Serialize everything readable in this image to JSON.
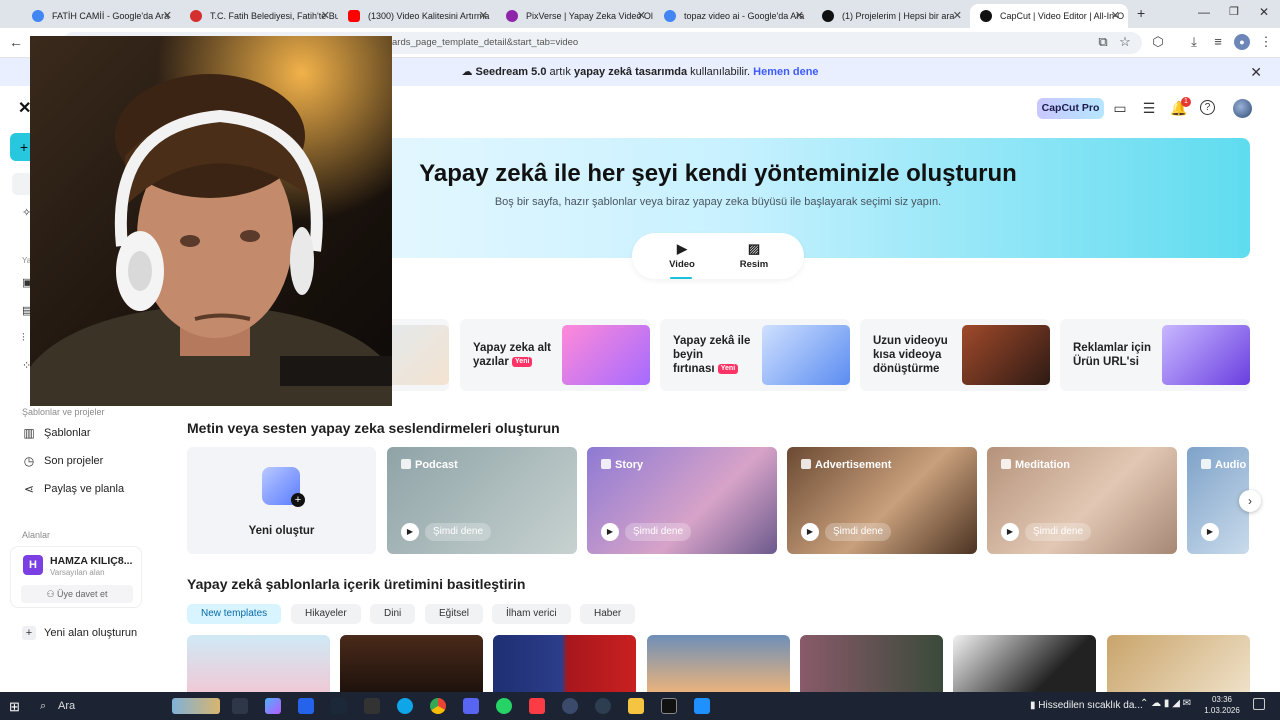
{
  "browser": {
    "tabs": [
      {
        "label": "FATİH CAMİİ - Google'da Ara",
        "color": "#4285f4"
      },
      {
        "label": "T.C. Fatih Belediyesi, Fatih'te Bu",
        "color": "#d32f2f"
      },
      {
        "label": "(1300) Video Kalitesini Artırma",
        "color": "#ff0000"
      },
      {
        "label": "PixVerse | Yapay Zeka Video Ol",
        "color": "#8e24aa"
      },
      {
        "label": "topaz video ai - Google'da Ara",
        "color": "#4285f4"
      },
      {
        "label": "(1) Projelerim | Hepsi bir ara",
        "color": "#111111"
      },
      {
        "label": "CapCut | Video Editor | All-In-O",
        "color": "#111111"
      }
    ],
    "address": "ards_page_template_detail&start_tab=video"
  },
  "banner": {
    "brand": "Seedream 5.0",
    "text_1": " artık ",
    "bold": "yapay zekâ tasarımda",
    "text_2": " kullanılabilir. ",
    "link": "Hemen dene"
  },
  "header": {
    "pro_label": "CapCut Pro",
    "notif_count": "1"
  },
  "sidebar": {
    "section_templates": "Şablonlar ve projeler",
    "items": [
      {
        "label": "Şablonlar"
      },
      {
        "label": "Son projeler"
      },
      {
        "label": "Paylaş ve planla"
      }
    ],
    "section_spaces": "Alanlar",
    "workspace": {
      "avatar": "H",
      "name": "HAMZA KILIÇ8...",
      "sub": "Varsayılan alan",
      "invite": "Üye davet et"
    },
    "new_space": "Yeni alan oluşturun"
  },
  "hero": {
    "title": "Yapay zekâ ile her şeyi kendi yönteminizle oluşturun",
    "subtitle": "Boş bir sayfa, hazır şablonlar veya biraz yapay zeka büyüsü ile başlayarak seçimi siz yapın.",
    "modes": [
      {
        "label": "Video"
      },
      {
        "label": "Resim"
      }
    ]
  },
  "features": [
    {
      "line1": "Yapay zeka alt",
      "line2": "yazılar",
      "badge": "Yeni"
    },
    {
      "line1": "Yapay zekâ ile",
      "line2": "beyin",
      "line3": "fırtınası",
      "badge": "Yeni"
    },
    {
      "line1": "Uzun videoyu",
      "line2": "kısa videoya",
      "line3": "dönüştürme"
    },
    {
      "line1": "Reklamlar için",
      "line2": "Ürün URL'si"
    }
  ],
  "voice": {
    "title": "Metin veya sesten yapay zeka seslendirmeleri oluşturun",
    "new_label": "Yeni oluştur",
    "try_label": "Şimdi dene",
    "cards": [
      {
        "label": "Podcast"
      },
      {
        "label": "Story"
      },
      {
        "label": "Advertisement"
      },
      {
        "label": "Meditation"
      },
      {
        "label": "Audio"
      }
    ]
  },
  "templates": {
    "title": "Yapay zekâ şablonlarla içerik üretimini basitleştirin",
    "chips": [
      "New templates",
      "Hikayeler",
      "Dini",
      "Eğitsel",
      "İlham verici",
      "Haber"
    ]
  },
  "taskbar": {
    "search": "Ara",
    "weather": "Hissedilen sıcaklık da...",
    "time": "03:36",
    "date": "1.03.2026"
  }
}
